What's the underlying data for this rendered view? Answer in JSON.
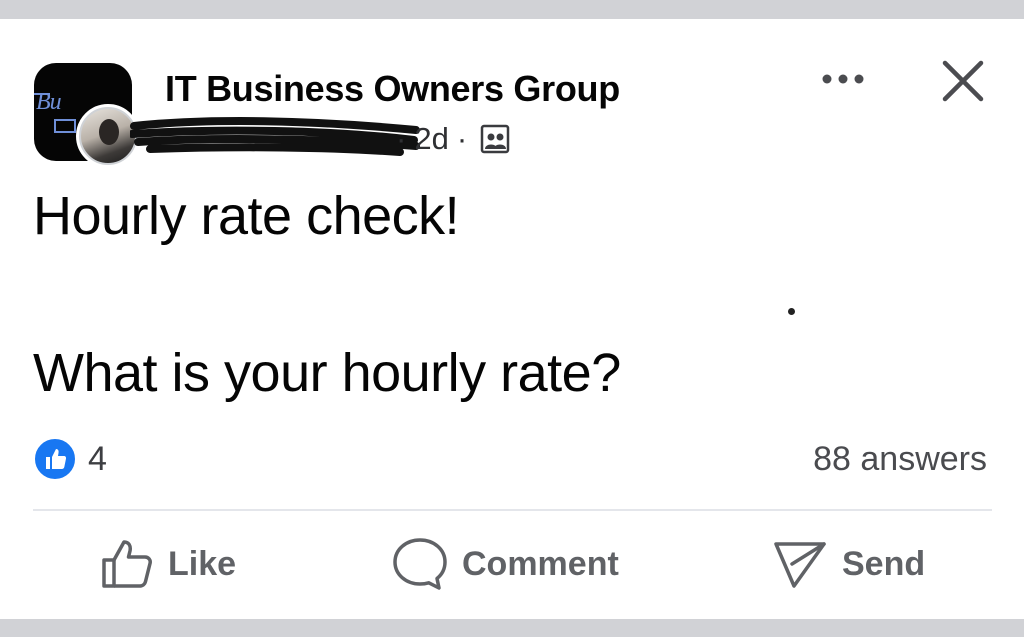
{
  "post": {
    "group_name": "IT Business Owners Group",
    "time_ago": "2d",
    "separator": "·",
    "body_line1": "Hourly rate check!",
    "body_line2": "What is your hourly rate?"
  },
  "stats": {
    "reaction_count": "4",
    "answers": "88 answers"
  },
  "actions": {
    "like_label": "Like",
    "comment_label": "Comment",
    "send_label": "Send"
  },
  "colors": {
    "accent": "#1877f2",
    "text": "#050505",
    "muted": "#65676b",
    "strip": "#d1d2d6"
  },
  "icons": {
    "more": "more-horizontal-icon",
    "close": "close-icon",
    "privacy": "members-icon",
    "like": "thumbs-up-icon",
    "comment": "speech-bubble-icon",
    "send": "send-arrow-icon"
  }
}
